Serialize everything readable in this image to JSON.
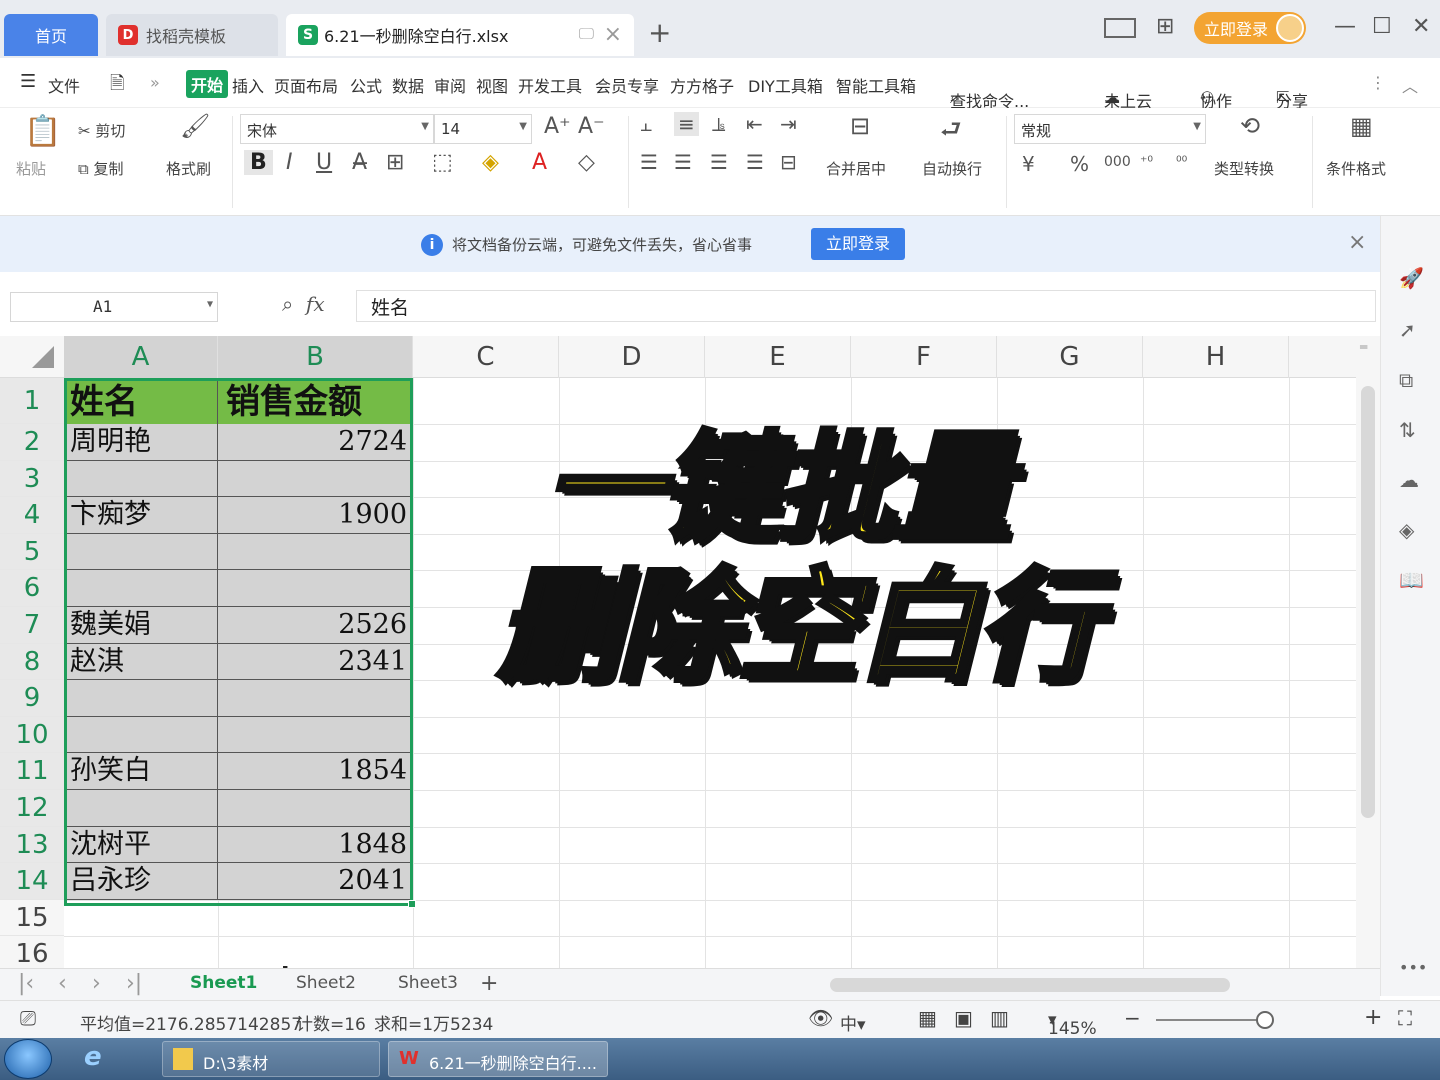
{
  "tabs": {
    "home": "首页",
    "template": "找稻壳模板",
    "file": "6.21一秒删除空白行.xlsx"
  },
  "top": {
    "login": "立即登录"
  },
  "menu": {
    "file": "文件",
    "items": [
      "开始",
      "插入",
      "页面布局",
      "公式",
      "数据",
      "审阅",
      "视图",
      "开发工具",
      "会员专享",
      "方方格子",
      "DIY工具箱",
      "智能工具箱"
    ],
    "search": "查找命令...",
    "cloud": "未上云",
    "collab": "协作",
    "share": "分享"
  },
  "ribbon": {
    "paste": "粘贴",
    "cut": "剪切",
    "copy": "复制",
    "format_painter": "格式刷",
    "font_name": "宋体",
    "font_size": "14",
    "merge": "合并居中",
    "wrap": "自动换行",
    "number_format": "常规",
    "currency": "¥",
    "percent": "%",
    "thousands": "000",
    "convert": "类型转换",
    "cond_format": "条件格式"
  },
  "notification": {
    "text": "将文档备份云端，可避免文件丢失，省心省事",
    "button": "立即登录"
  },
  "formula": {
    "cell_ref": "A1",
    "fx": "fx",
    "value": "姓名"
  },
  "columns": [
    "A",
    "B",
    "C",
    "D",
    "E",
    "F",
    "G",
    "H"
  ],
  "rows": [
    "1",
    "2",
    "3",
    "4",
    "5",
    "6",
    "7",
    "8",
    "9",
    "10",
    "11",
    "12",
    "13",
    "14",
    "15",
    "16"
  ],
  "table": {
    "header": [
      "姓名",
      "销售金额"
    ],
    "data": [
      [
        "周明艳",
        "2724"
      ],
      [
        "",
        ""
      ],
      [
        "卞痴梦",
        "1900"
      ],
      [
        "",
        ""
      ],
      [
        "",
        ""
      ],
      [
        "魏美娟",
        "2526"
      ],
      [
        "赵淇",
        "2341"
      ],
      [
        "",
        ""
      ],
      [
        "",
        ""
      ],
      [
        "孙笑白",
        "1854"
      ],
      [
        "",
        ""
      ],
      [
        "沈树平",
        "1848"
      ],
      [
        "吕永珍",
        "2041"
      ]
    ]
  },
  "overlay": {
    "line1": "一键批量",
    "line2": "删除空白行"
  },
  "sheets": [
    "Sheet1",
    "Sheet2",
    "Sheet3"
  ],
  "status": {
    "average": "平均值=2176.2857142857",
    "count": "计数=16",
    "sum": "求和=1万5234",
    "zoom": "145%"
  },
  "taskbar": {
    "folder": "D:\\3素材",
    "wps": "6.21一秒删除空白行...."
  },
  "colors": {
    "accent_green": "#1e9e5a",
    "header_fill": "#74bb46",
    "overlay_yellow": "#ffe81a",
    "tab_blue": "#4a83e8"
  }
}
